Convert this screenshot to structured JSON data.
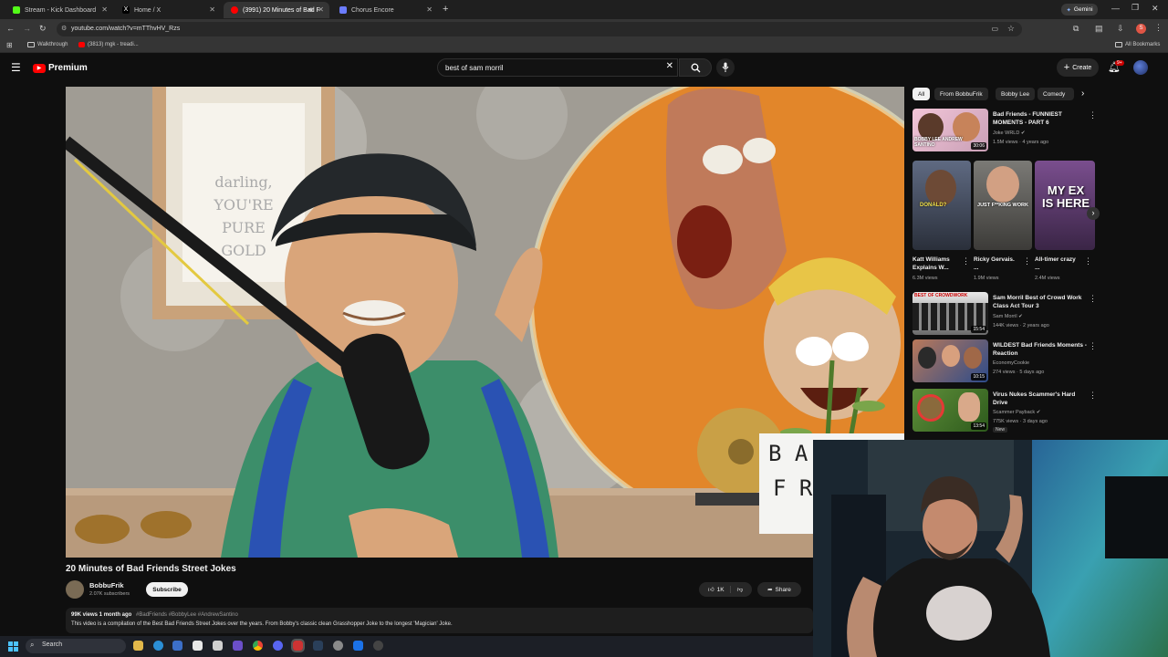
{
  "browser": {
    "tabs": [
      {
        "label": "Stream - Kick Dashboard",
        "color": "#53fc18"
      },
      {
        "label": "Home / X",
        "color": "#ffffff"
      },
      {
        "label": "(3991) 20 Minutes of Bad F",
        "color": "#ff0000"
      },
      {
        "label": "Chorus Encore",
        "color": "#6b7cff"
      }
    ],
    "gemini_label": "Gemini",
    "url": "youtube.com/watch?v=mTThvHV_Rzs",
    "bookmarks": [
      {
        "label": "Walkthrough"
      },
      {
        "label": "(3813) mgk - treadi..."
      }
    ],
    "all_bookmarks_label": "All Bookmarks"
  },
  "youtube": {
    "logo_text": "Premium",
    "search_value": "best of sam morril",
    "create_label": "Create",
    "notif_badge": "9+",
    "chips": [
      "All",
      "From BobbuFrik",
      "Bobby Lee",
      "Comedy"
    ]
  },
  "player": {
    "sign_text": "darling, YOU'RE PURE GOLD",
    "card_text": "BAD FRI"
  },
  "video": {
    "title": "20 Minutes of Bad Friends Street Jokes",
    "channel": "BobbuFrik",
    "subscribers": "2.07K subscribers",
    "subscribe_label": "Subscribe",
    "likes": "1K",
    "share_label": "Share",
    "views_date": "99K views  1 month ago",
    "hashtags": "#BadFriends #BobbyLee #AndrewSantino",
    "description": "This video is a compilation of the Best Bad Friends Street Jokes over the years. From Bobby's classic clean Grasshopper Joke to the longest 'Magician' Joke."
  },
  "recommendations": [
    {
      "title": "Bad Friends - FUNNIEST MOMENTS - PART 6",
      "channel": "Joke WRLD",
      "verified": true,
      "meta": "1.5M views · 4 years ago",
      "duration": "30:06",
      "thumb_text": "BOBBY LEE ANDREW SANTINO"
    },
    {
      "title": "Sam Morril Best of Crowd Work Class Act Tour 3",
      "channel": "Sam Morril",
      "verified": true,
      "meta": "144K views · 2 years ago",
      "duration": "15:54",
      "thumb_text": "BEST OF CROWDWORK"
    },
    {
      "title": "WILDEST Bad Friends Moments - Reaction",
      "channel": "EconomyCookie",
      "verified": false,
      "meta": "274 views · 5 days ago",
      "duration": "10:15",
      "badge": ""
    },
    {
      "title": "Virus Nukes Scammer's Hard Drive",
      "channel": "Scammer Payback",
      "verified": true,
      "meta": "775K views · 3 days ago",
      "duration": "13:54",
      "badge": "New"
    }
  ],
  "shorts": [
    {
      "title": "Katt Williams Explains W...",
      "views": "6.3M views",
      "thumb_text": "DONALD?"
    },
    {
      "title": "Ricky Gervais. ...",
      "views": "1.9M views",
      "thumb_text": "JUST F**KING WORK"
    },
    {
      "title": "All-timer crazy ...",
      "views": "2.4M views",
      "thumb_text": "MY EX IS HERE"
    }
  ],
  "taskbar": {
    "search_label": "Search"
  }
}
